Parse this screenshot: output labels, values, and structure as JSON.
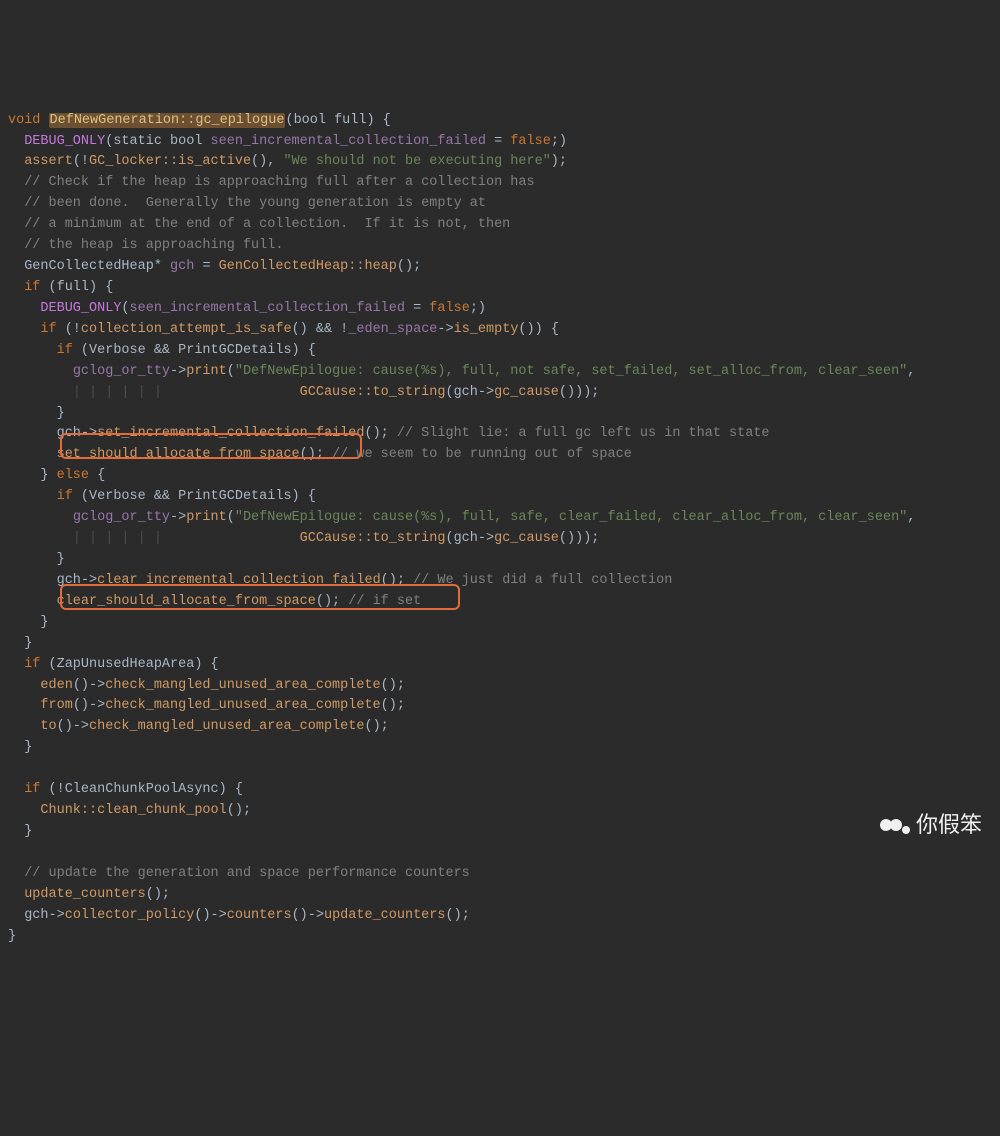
{
  "watermark": {
    "text": "你假笨"
  },
  "highlight": {
    "box1_label": "set_should_allocate_from_space",
    "box2_label": "clear_should_allocate_from_space"
  },
  "code": {
    "sig_void": "void",
    "sig_class": "DefNewGeneration::gc_epilogue",
    "sig_param": "(bool full) {",
    "l2_mac": "DEBUG_ONLY",
    "l2_rest_a": "(static bool ",
    "l2_var": "seen_incremental_collection_failed",
    "l2_rest_b": " = ",
    "l2_false": "false",
    "l2_rest_c": ";)",
    "l3_assert": "assert",
    "l3_a": "(!",
    "l3_call": "GC_locker::is_active",
    "l3_b": "(), ",
    "l3_str": "\"We should not be executing here\"",
    "l3_c": ");",
    "c1": "// Check if the heap is approaching full after a collection has",
    "c2": "// been done.  Generally the young generation is empty at",
    "c3": "// a minimum at the end of a collection.  If it is not, then",
    "c4": "// the heap is approaching full.",
    "l8_a": "GenCollectedHeap* ",
    "l8_var": "gch",
    "l8_b": " = ",
    "l8_call": "GenCollectedHeap::heap",
    "l8_c": "();",
    "l9_if": "if",
    "l9_a": " (full) {",
    "l10_mac": "DEBUG_ONLY",
    "l10_a": "(",
    "l10_var": "seen_incremental_collection_failed",
    "l10_b": " = ",
    "l10_false": "false",
    "l10_c": ";)",
    "l11_if": "if",
    "l11_a": " (!",
    "l11_call1": "collection_attempt_is_safe",
    "l11_b": "() && !",
    "l11_var": "_eden_space",
    "l11_c": "->",
    "l11_call2": "is_empty",
    "l11_d": "()) {",
    "l12_if": "if",
    "l12_a": " (Verbose && PrintGCDetails) {",
    "l13_obj": "gclog_or_tty",
    "l13_a": "->",
    "l13_call": "print",
    "l13_b": "(",
    "l13_str": "\"DefNewEpilogue: cause(%s), full, not safe, set_failed, set_alloc_from, clear_seen\"",
    "l13_c": ",",
    "l14_pad": "                ",
    "l14_call": "GCCause::to_string",
    "l14_a": "(gch->",
    "l14_call2": "gc_cause",
    "l14_b": "()));",
    "l15": "}",
    "l16_a": "gch->",
    "l16_call": "set_incremental_collection_failed",
    "l16_b": "(); ",
    "l16_cmt": "// Slight lie: a full gc left us in that state",
    "l17_call": "set_should_allocate_from_space",
    "l17_a": "(); ",
    "l17_cmt": "// we seem to be running out of space",
    "l18_a": "} ",
    "l18_else": "else",
    "l18_b": " {",
    "l19_if": "if",
    "l19_a": " (Verbose && PrintGCDetails) {",
    "l20_obj": "gclog_or_tty",
    "l20_a": "->",
    "l20_call": "print",
    "l20_b": "(",
    "l20_str": "\"DefNewEpilogue: cause(%s), full, safe, clear_failed, clear_alloc_from, clear_seen\"",
    "l20_c": ",",
    "l21_pad": "                ",
    "l21_call": "GCCause::to_string",
    "l21_a": "(gch->",
    "l21_call2": "gc_cause",
    "l21_b": "()));",
    "l22": "}",
    "l23_a": "gch->",
    "l23_call": "clear_incremental_collection_failed",
    "l23_b": "(); ",
    "l23_cmt": "// We just did a full collection",
    "l24_call": "clear_should_allocate_from_space",
    "l24_a": "(); ",
    "l24_cmt": "// if set",
    "l25": "}",
    "l26": "}",
    "l27_if": "if",
    "l27_a": " (ZapUnusedHeapArea) {",
    "l28_call0": "eden",
    "l28_a": "()->",
    "l28_call": "check_mangled_unused_area_complete",
    "l28_b": "();",
    "l29_call0": "from",
    "l29_a": "()->",
    "l29_call": "check_mangled_unused_area_complete",
    "l29_b": "();",
    "l30_call0": "to",
    "l30_a": "()->",
    "l30_call": "check_mangled_unused_area_complete",
    "l30_b": "();",
    "l31": "}",
    "l33_if": "if",
    "l33_a": " (!CleanChunkPoolAsync) {",
    "l34_call": "Chunk::clean_chunk_pool",
    "l34_a": "();",
    "l35": "}",
    "c5": "// update the generation and space performance counters",
    "l38_call": "update_counters",
    "l38_a": "();",
    "l39_a": "gch->",
    "l39_call1": "collector_policy",
    "l39_b": "()->",
    "l39_call2": "counters",
    "l39_c": "()->",
    "l39_call3": "update_counters",
    "l39_d": "();",
    "l40": "}"
  }
}
